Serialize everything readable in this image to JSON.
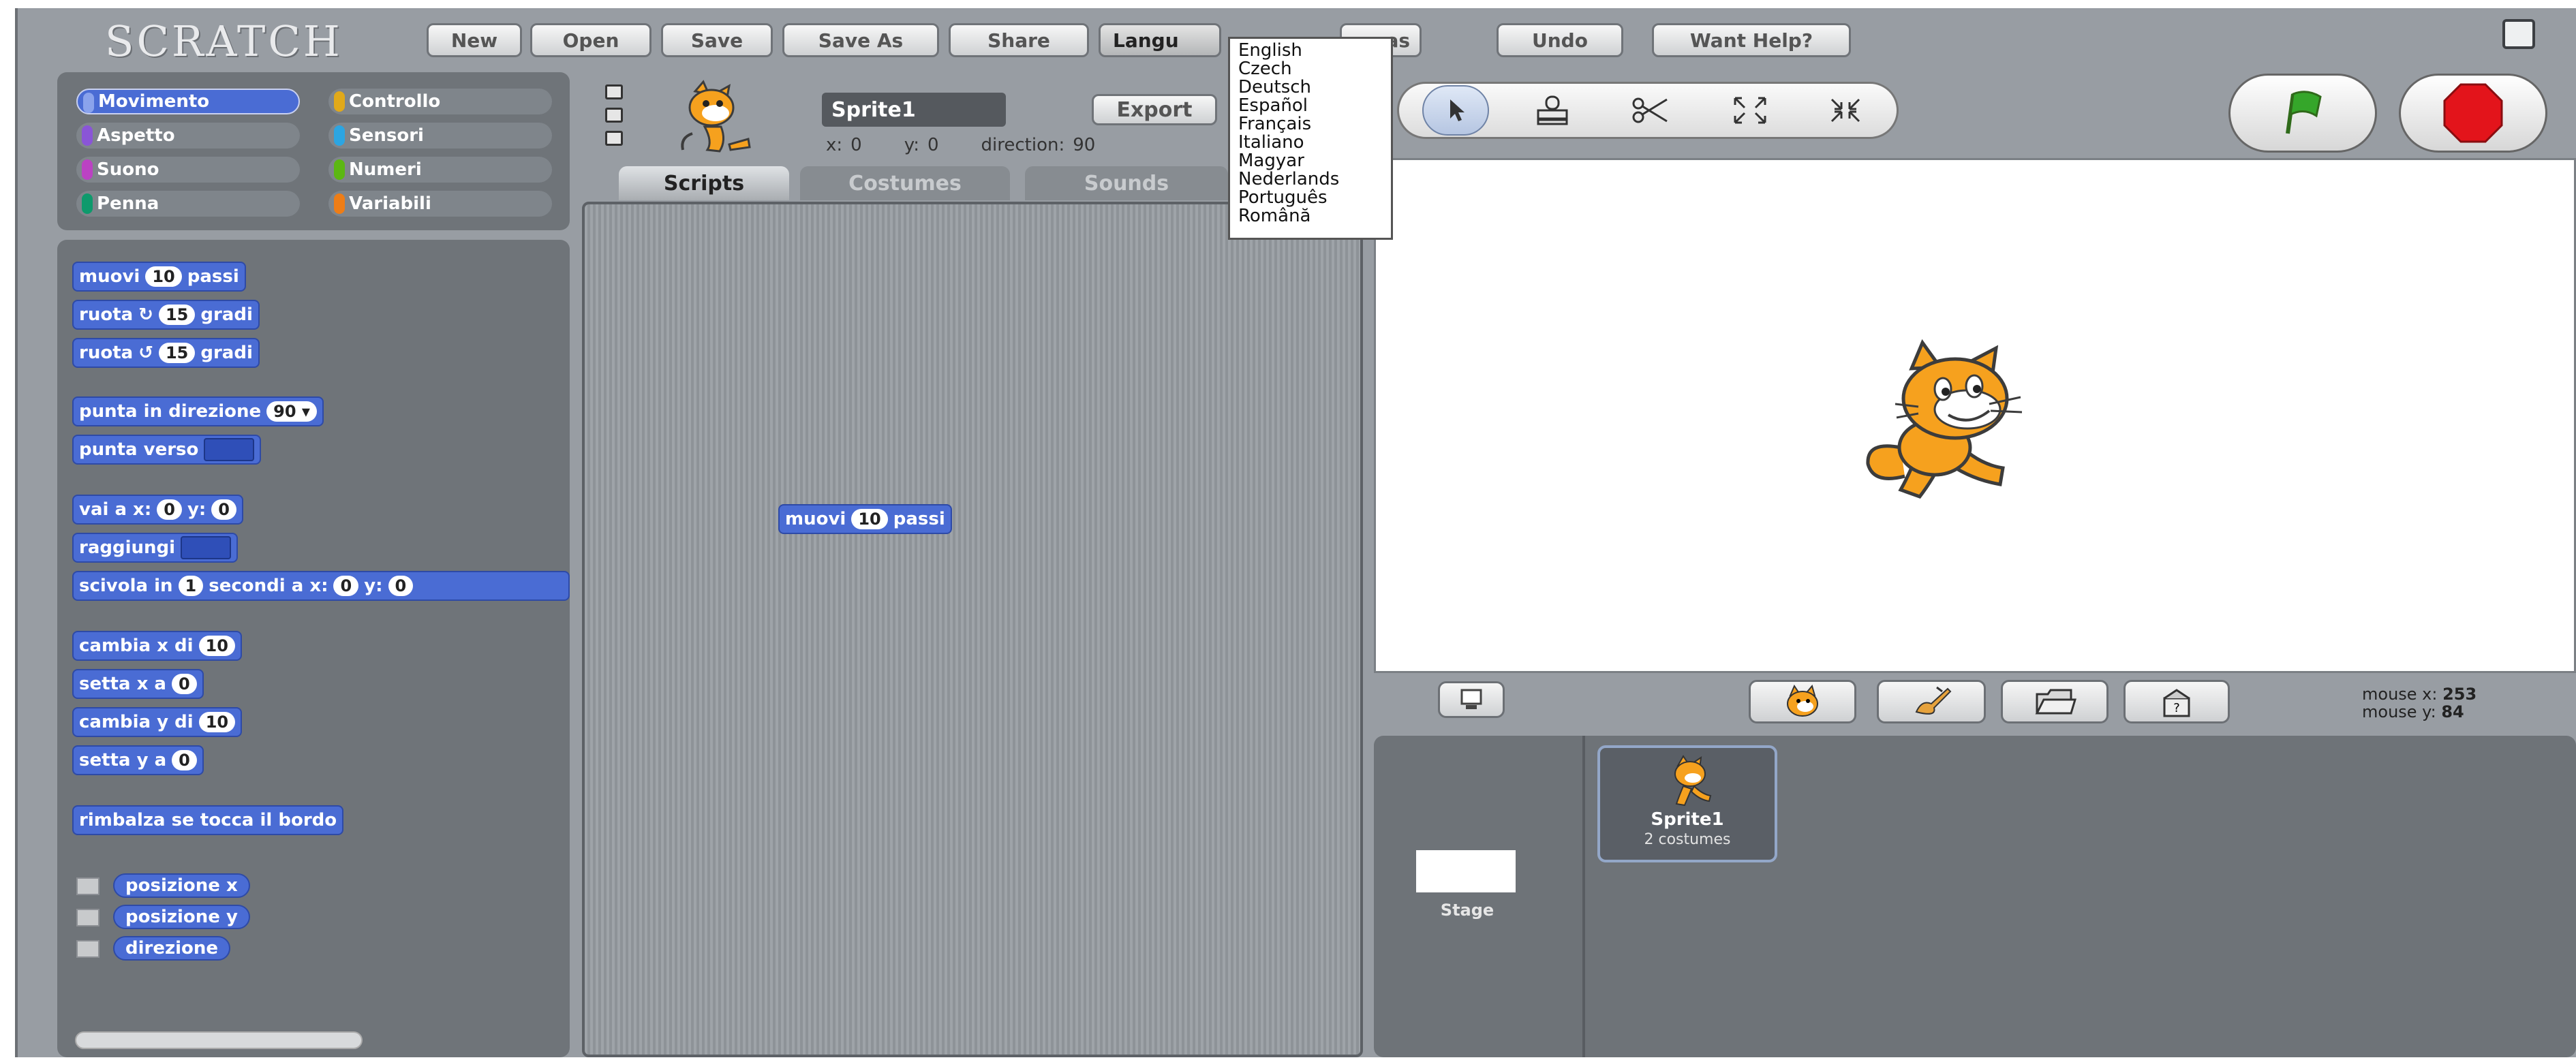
{
  "app": {
    "logo": "SCRATCH"
  },
  "menu": {
    "new": "New",
    "open": "Open",
    "save": "Save",
    "save_as": "Save As",
    "share": "Share",
    "language": "Langu",
    "ideas": "as",
    "undo": "Undo",
    "help": "Want Help?"
  },
  "language_menu": [
    "English",
    "Czech",
    "Deutsch",
    "Español",
    "Français",
    "Italiano",
    "Magyar",
    "Nederlands",
    "Português",
    "Română"
  ],
  "categories": [
    {
      "label": "Movimento",
      "color": "#4a6cd4",
      "active": true
    },
    {
      "label": "Controllo",
      "color": "#e1a91a"
    },
    {
      "label": "Aspetto",
      "color": "#8a55d7"
    },
    {
      "label": "Sensori",
      "color": "#2ca5e2"
    },
    {
      "label": "Suono",
      "color": "#bb42c3"
    },
    {
      "label": "Numeri",
      "color": "#5cb712"
    },
    {
      "label": "Penna",
      "color": "#0e9a6c"
    },
    {
      "label": "Variabili",
      "color": "#ee7d16"
    }
  ],
  "blocks": {
    "move": {
      "pre": "muovi",
      "num": "10",
      "post": "passi"
    },
    "turn_right": {
      "pre": "ruota",
      "icon": "↻",
      "num": "15",
      "post": "gradi"
    },
    "turn_left": {
      "pre": "ruota",
      "icon": "↺",
      "num": "15",
      "post": "gradi"
    },
    "point_dir": {
      "pre": "punta in direzione",
      "num": "90 ▾"
    },
    "point_towards": {
      "pre": "punta verso"
    },
    "goto_xy": {
      "pre": "vai a x:",
      "x": "0",
      "mid": "y:",
      "y": "0"
    },
    "goto": {
      "pre": "raggiungi"
    },
    "glide": {
      "pre": "scivola in",
      "num": "1",
      "mid": "secondi a x:",
      "x": "0",
      "mid2": "y:",
      "y": "0"
    },
    "change_x": {
      "pre": "cambia x di",
      "num": "10"
    },
    "set_x": {
      "pre": "setta x a",
      "num": "0"
    },
    "change_y": {
      "pre": "cambia y di",
      "num": "10"
    },
    "set_y": {
      "pre": "setta y a",
      "num": "0"
    },
    "bounce": {
      "pre": "rimbalza se tocca il bordo"
    },
    "reporters": [
      "posizione x",
      "posizione y",
      "direzione"
    ]
  },
  "sprite": {
    "name": "Sprite1",
    "export": "Export",
    "x_label": "x:",
    "x": "0",
    "y_label": "y:",
    "y": "0",
    "direction_label": "direction:",
    "direction": "90"
  },
  "tabs": [
    {
      "label": "Scripts",
      "active": true
    },
    {
      "label": "Costumes"
    },
    {
      "label": "Sounds"
    }
  ],
  "script_block": {
    "pre": "muovi",
    "num": "10",
    "post": "passi"
  },
  "mouse": {
    "x_label": "mouse x:",
    "x": "253",
    "y_label": "mouse y:",
    "y": "84"
  },
  "sprite_list": [
    {
      "name": "Sprite1",
      "info": "2 costumes"
    }
  ],
  "stage_thumb": {
    "label": "Stage"
  }
}
